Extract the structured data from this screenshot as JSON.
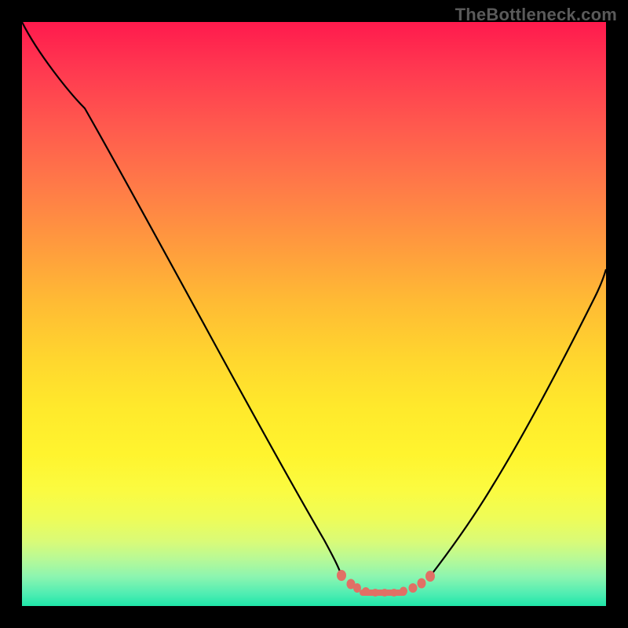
{
  "watermark": {
    "text": "TheBottleneck.com"
  },
  "colors": {
    "curve_stroke": "#000000",
    "dot_fill": "#e17065",
    "dot_stroke": "#e17065"
  },
  "chart_data": {
    "type": "line",
    "title": "",
    "xlabel": "",
    "ylabel": "",
    "xlim": [
      0,
      100
    ],
    "ylim": [
      0,
      100
    ],
    "grid": false,
    "legend": false,
    "series": [
      {
        "name": "left-curve",
        "x": [
          0,
          4,
          10,
          16,
          22,
          28,
          34,
          40,
          46,
          50,
          53
        ],
        "values": [
          100,
          95,
          86,
          76,
          65,
          54,
          43,
          32,
          20,
          10,
          5
        ]
      },
      {
        "name": "right-curve",
        "x": [
          70,
          74,
          78,
          82,
          86,
          90,
          94,
          98,
          100
        ],
        "values": [
          5,
          9,
          15,
          22,
          30,
          38,
          47,
          56,
          60
        ]
      },
      {
        "name": "dots",
        "type": "scatter",
        "x": [
          53,
          55,
          56,
          58,
          60,
          62,
          64,
          66,
          68,
          69,
          70
        ],
        "values": [
          5,
          3.5,
          2.8,
          2.2,
          2,
          2,
          2,
          2.4,
          3,
          4,
          5
        ]
      }
    ]
  }
}
